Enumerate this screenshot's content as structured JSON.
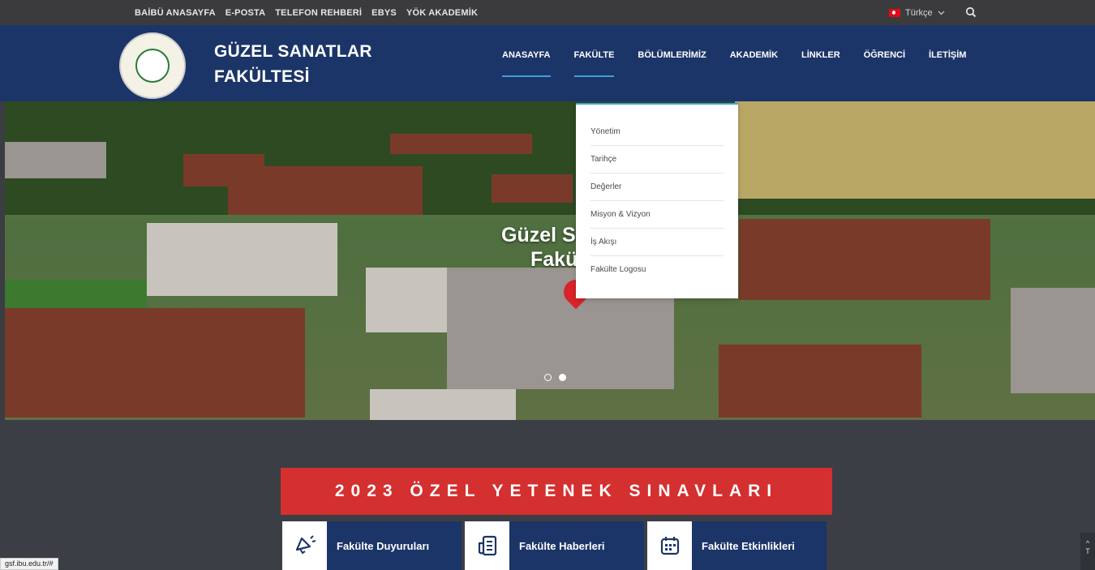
{
  "topbar": {
    "links": [
      "BAİBÜ ANASAYFA",
      "E-POSTA",
      "TELEFON REHBERİ",
      "EBYS",
      "YÖK AKADEMİK"
    ],
    "language": "Türkçe"
  },
  "header": {
    "site_name_line1": "GÜZEL SANATLAR",
    "site_name_line2": "FAKÜLTESİ",
    "nav": [
      "ANASAYFA",
      "FAKÜLTE",
      "BÖLÜMLERİMİZ",
      "AKADEMİK",
      "LİNKLER",
      "ÖĞRENCİ",
      "İLETİŞİM"
    ]
  },
  "dropdown": {
    "items": [
      "Yönetim",
      "Tarihçe",
      "Değerler",
      "Misyon & Vizyon",
      "İş Akışı",
      "Fakülte Logosu"
    ]
  },
  "hero": {
    "title_line1": "Güzel Sa",
    "title_line2": "Fakü"
  },
  "banner": {
    "text": "2023 ÖZEL YETENEK SINAVLARI"
  },
  "cards": [
    "Fakülte Duyuruları",
    "Fakülte Haberleri",
    "Fakülte Etkinlikleri"
  ],
  "status": {
    "url": "gsf.ibu.edu.tr/#"
  },
  "totop": {
    "label": "T"
  },
  "colors": {
    "navy": "#1c3568",
    "red": "#d3302f",
    "accent": "#3fa0d9"
  }
}
